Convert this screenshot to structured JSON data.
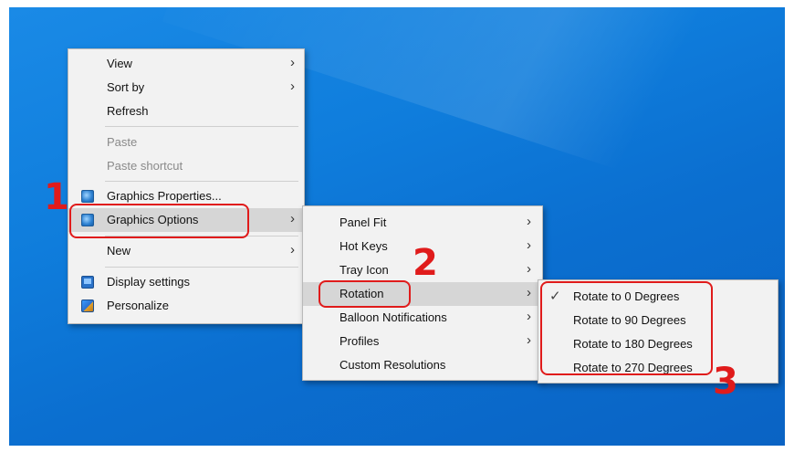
{
  "context_menu": {
    "items": [
      {
        "label": "View",
        "submenu": true
      },
      {
        "label": "Sort by",
        "submenu": true
      },
      {
        "label": "Refresh"
      },
      {
        "label": "Paste",
        "disabled": true
      },
      {
        "label": "Paste shortcut",
        "disabled": true
      },
      {
        "label": "Graphics Properties...",
        "icon": "graphics-icon"
      },
      {
        "label": "Graphics Options",
        "icon": "graphics-icon",
        "submenu": true,
        "highlighted": true
      },
      {
        "label": "New",
        "submenu": true
      },
      {
        "label": "Display settings",
        "icon": "display-icon"
      },
      {
        "label": "Personalize",
        "icon": "personalize-icon"
      }
    ]
  },
  "graphics_submenu": {
    "items": [
      {
        "label": "Panel Fit",
        "submenu": true
      },
      {
        "label": "Hot Keys",
        "submenu": true
      },
      {
        "label": "Tray Icon",
        "submenu": true
      },
      {
        "label": "Rotation",
        "submenu": true,
        "highlighted": true
      },
      {
        "label": "Balloon Notifications",
        "submenu": true
      },
      {
        "label": "Profiles",
        "submenu": true
      },
      {
        "label": "Custom Resolutions"
      }
    ]
  },
  "rotation_submenu": {
    "items": [
      {
        "label": "Rotate to 0 Degrees",
        "checked": true
      },
      {
        "label": "Rotate to 90 Degrees"
      },
      {
        "label": "Rotate to 180 Degrees"
      },
      {
        "label": "Rotate to 270 Degrees"
      }
    ]
  },
  "annotations": {
    "step1": "1",
    "step2": "2",
    "step3": "3",
    "color": "#e01b1b"
  },
  "glyphs": {
    "chevron": "›",
    "check": "✓"
  }
}
